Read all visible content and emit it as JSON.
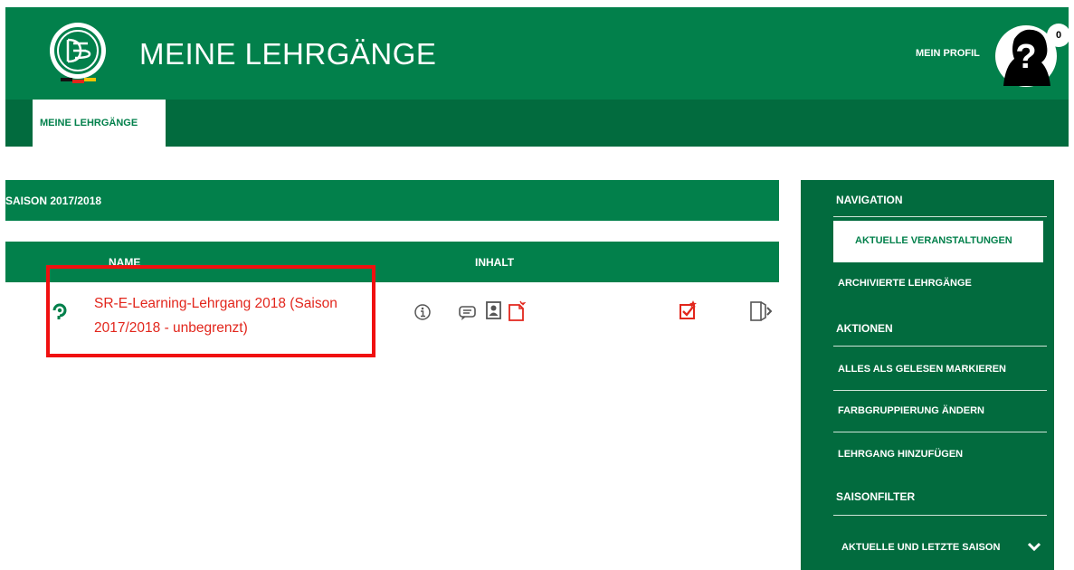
{
  "header": {
    "title": "MEINE LEHRGÄNGE",
    "profile_label": "MEIN PROFIL",
    "notification_count": "0"
  },
  "subnav": {
    "tabs": [
      {
        "label": "MEINE LEHRGÄNGE",
        "active": true
      }
    ]
  },
  "main": {
    "season_title": "SAISON 2017/2018",
    "columns": {
      "name": "NAME",
      "content": "INHALT"
    },
    "courses": [
      {
        "title": "SR-E-Learning-Lehrgang 2018 (Saison 2017/2018 - unbegrenzt)",
        "content_icons": [
          "info-icon",
          "chat-icon",
          "contact-icon",
          "document-icon"
        ],
        "status_icon": "task-icon",
        "action_icon": "exit-icon"
      }
    ]
  },
  "sidebar": {
    "navigation_heading": "NAVIGATION",
    "navigation_items": [
      {
        "label": "AKTUELLE VERANSTALTUNGEN",
        "active": true
      },
      {
        "label": "ARCHIVIERTE LEHRGÄNGE",
        "active": false
      }
    ],
    "actions_heading": "AKTIONEN",
    "action_items": [
      {
        "label": "ALLES ALS GELESEN MARKIEREN"
      },
      {
        "label": "FARBGRUPPIERUNG ÄNDERN"
      },
      {
        "label": "LEHRGANG HINZUFÜGEN"
      }
    ],
    "filter_heading": "SAISONFILTER",
    "filter_selected": "AKTUELLE UND LETZTE SAISON"
  },
  "colors": {
    "brand_green": "#02804b",
    "sidebar_green": "#026b3e",
    "link_red": "#e2261c",
    "highlight_red": "#f01010"
  }
}
